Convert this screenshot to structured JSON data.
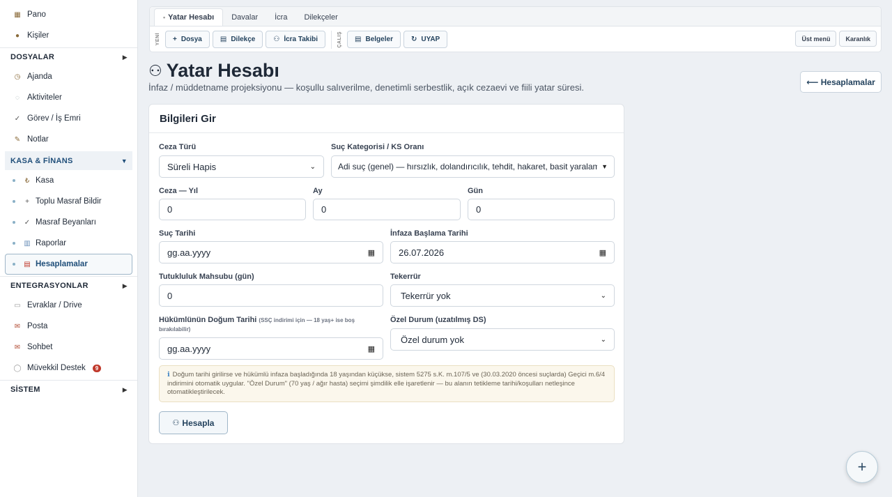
{
  "sidebar": {
    "top_items": [
      {
        "label": "Pano",
        "icon": "dashboard-icon"
      },
      {
        "label": "Kişiler",
        "icon": "people-icon"
      }
    ],
    "dosyalar": {
      "title": "DOSYALAR"
    },
    "dosyalar_items": [
      {
        "label": "Ajanda",
        "icon": "clock-icon"
      },
      {
        "label": "Aktiviteler",
        "icon": "activity-icon"
      },
      {
        "label": "Görev / İş Emri",
        "icon": "check-icon"
      },
      {
        "label": "Notlar",
        "icon": "pencil-icon"
      }
    ],
    "kasa": {
      "title": "KASA & FİNANS"
    },
    "kasa_items": [
      {
        "label": "Kasa",
        "icon": "lira-icon"
      },
      {
        "label": "Toplu Masraf Bildir",
        "icon": "plus-icon"
      },
      {
        "label": "Masraf Beyanları",
        "icon": "check-icon"
      },
      {
        "label": "Raporlar",
        "icon": "chart-icon"
      },
      {
        "label": "Hesaplamalar",
        "icon": "calculator-icon"
      }
    ],
    "entegrasyonlar": {
      "title": "ENTEGRASYONLAR"
    },
    "entegrasyonlar_items": [
      {
        "label": "Evraklar / Drive",
        "icon": "folder-icon"
      },
      {
        "label": "Posta",
        "icon": "mail-icon"
      },
      {
        "label": "Sohbet",
        "icon": "mail-icon"
      },
      {
        "label": "Müvekkil Destek",
        "icon": "chat-icon",
        "badge": "9"
      }
    ],
    "sistem": {
      "title": "SİSTEM"
    }
  },
  "toolbar": {
    "tabs": [
      "Yatar Hesabı",
      "Davalar",
      "İcra",
      "Dilekçeler"
    ],
    "new_label": "YENİ",
    "work_label": "ÇALIŞ",
    "buttons": [
      {
        "label": "Dosya",
        "icon": "plus-icon"
      },
      {
        "label": "Dilekçe",
        "icon": "document-icon"
      },
      {
        "label": "İcra Takibi",
        "icon": "binoculars-icon"
      }
    ],
    "work_buttons": [
      {
        "label": "Belgeler",
        "icon": "document-icon"
      },
      {
        "label": "UYAP",
        "icon": "refresh-icon"
      }
    ],
    "top_menu": "Üst menü",
    "dark": "Karanlık"
  },
  "page": {
    "title": "Yatar Hesabı",
    "subtitle": "İnfaz / müddetname projeksiyonu — koşullu salıverilme, denetimli serbestlik, açık cezaevi ve fiili yatar süresi.",
    "back_label": "⟵ Hesaplamalar"
  },
  "form": {
    "title": "Bilgileri Gir",
    "ceza_turu": {
      "label": "Ceza Türü",
      "value": "Süreli Hapis"
    },
    "suc_kategorisi": {
      "label": "Suç Kategorisi / KS Oranı",
      "value": "Adi suç (genel) — hırsızlık, dolandırıcılık, tehdit, hakaret, basit yaralama"
    },
    "ceza_yil": {
      "label": "Ceza — Yıl",
      "value": "0"
    },
    "ay": {
      "label": "Ay",
      "value": "0"
    },
    "gun": {
      "label": "Gün",
      "value": "0"
    },
    "suc_tarihi": {
      "label": "Suç Tarihi",
      "value": "gg.aa.yyyy"
    },
    "infaz_baslama": {
      "label": "İnfaza Başlama Tarihi",
      "value": "26.07.2026"
    },
    "tutukluluk": {
      "label": "Tutukluluk Mahsubu (gün)",
      "value": "0"
    },
    "tekerrur": {
      "label": "Tekerrür",
      "value": "Tekerrür yok"
    },
    "dogum": {
      "label": "Hükümlünün Doğum Tarihi",
      "note": "(SSÇ indirimi için — 18 yaş+ ise boş bırakılabilir)",
      "value": "gg.aa.yyyy"
    },
    "ozel_durum": {
      "label": "Özel Durum (uzatılmış DS)",
      "value": "Özel durum yok"
    },
    "info": "Doğum tarihi girilirse ve hükümlü infaza başladığında 18 yaşından küçükse, sistem 5275 s.K. m.107/5 ve (30.03.2020 öncesi suçlarda) Geçici m.6/4 indirimini otomatik uygular. \"Özel Durum\" (70 yaş / ağır hasta) seçimi şimdilik elle işaretlenir — bu alanın tetikleme tarihi/koşulları netleşince otomatikleştirilecek.",
    "calc_button": "Hesapla"
  }
}
